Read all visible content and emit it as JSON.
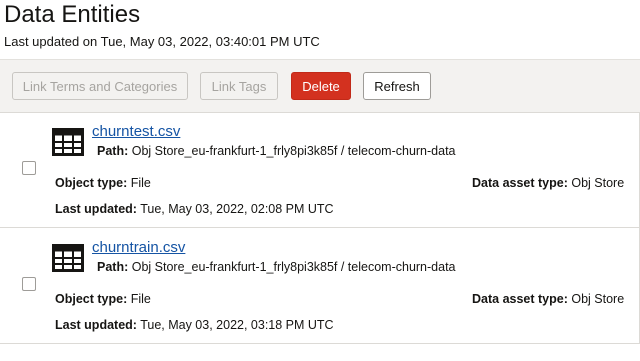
{
  "page": {
    "title": "Data Entities",
    "last_updated": "Last updated on Tue, May 03, 2022, 03:40:01 PM UTC"
  },
  "toolbar": {
    "link_terms_label": "Link Terms and Categories",
    "link_tags_label": "Link Tags",
    "delete_label": "Delete",
    "refresh_label": "Refresh",
    "delete_color": "#d3311f"
  },
  "entities": [
    {
      "name": "churntest.csv",
      "path_label": "Path:",
      "path_value": "Obj Store_eu-frankfurt-1_frly8pi3k85f / telecom-churn-data",
      "object_type_label": "Object type:",
      "object_type": "File",
      "asset_type_label": "Data asset type:",
      "asset_type": "Obj Store",
      "updated_label": "Last updated:",
      "updated": "Tue, May 03, 2022, 02:08 PM UTC"
    },
    {
      "name": "churntrain.csv",
      "path_label": "Path:",
      "path_value": "Obj Store_eu-frankfurt-1_frly8pi3k85f / telecom-churn-data",
      "object_type_label": "Object type:",
      "object_type": "File",
      "asset_type_label": "Data asset type:",
      "asset_type": "Obj Store",
      "updated_label": "Last updated:",
      "updated": "Tue, May 03, 2022, 03:18 PM UTC"
    }
  ],
  "footer": {
    "text": ""
  },
  "icons": {
    "file": "table-icon"
  }
}
